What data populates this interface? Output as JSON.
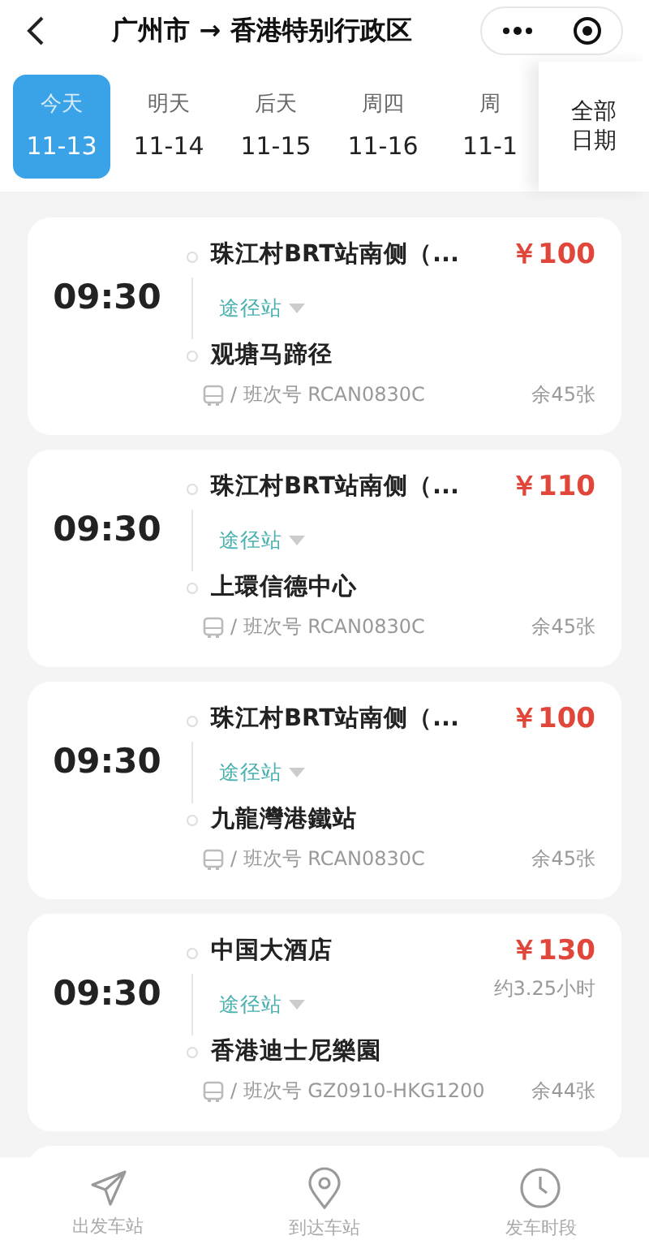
{
  "header": {
    "title": "广州市 → 香港特别行政区"
  },
  "dates": [
    {
      "weekday": "今天",
      "date": "11-13",
      "selected": true
    },
    {
      "weekday": "明天",
      "date": "11-14",
      "selected": false
    },
    {
      "weekday": "后天",
      "date": "11-15",
      "selected": false
    },
    {
      "weekday": "周四",
      "date": "11-16",
      "selected": false
    },
    {
      "weekday": "周",
      "date": "11-1",
      "selected": false
    }
  ],
  "all_dates_button": "全部日期",
  "trips": [
    {
      "time": "09:30",
      "from": "珠江村BRT站南侧（...",
      "via": "途径站",
      "to": "观塘马蹄径",
      "price": "￥100",
      "trip_no": "/ 班次号 RCAN0830C",
      "seats": "余45张"
    },
    {
      "time": "09:30",
      "from": "珠江村BRT站南侧（...",
      "via": "途径站",
      "to": "上環信德中心",
      "price": "￥110",
      "trip_no": "/ 班次号 RCAN0830C",
      "seats": "余45张"
    },
    {
      "time": "09:30",
      "from": "珠江村BRT站南侧（...",
      "via": "途径站",
      "to": "九龍灣港鐵站",
      "price": "￥100",
      "trip_no": "/ 班次号 RCAN0830C",
      "seats": "余45张"
    },
    {
      "time": "09:30",
      "from": "中国大酒店",
      "via": "途径站",
      "to": "香港迪士尼樂園",
      "price": "￥130",
      "duration": "约3.25小时",
      "trip_no": "/ 班次号 GZ0910-HKG1200",
      "seats": "余44张"
    }
  ],
  "bottom_bar": [
    {
      "kind": "send",
      "label": "出发车站"
    },
    {
      "kind": "pin",
      "label": "到达车站"
    },
    {
      "kind": "clock",
      "label": "发车时段"
    }
  ]
}
